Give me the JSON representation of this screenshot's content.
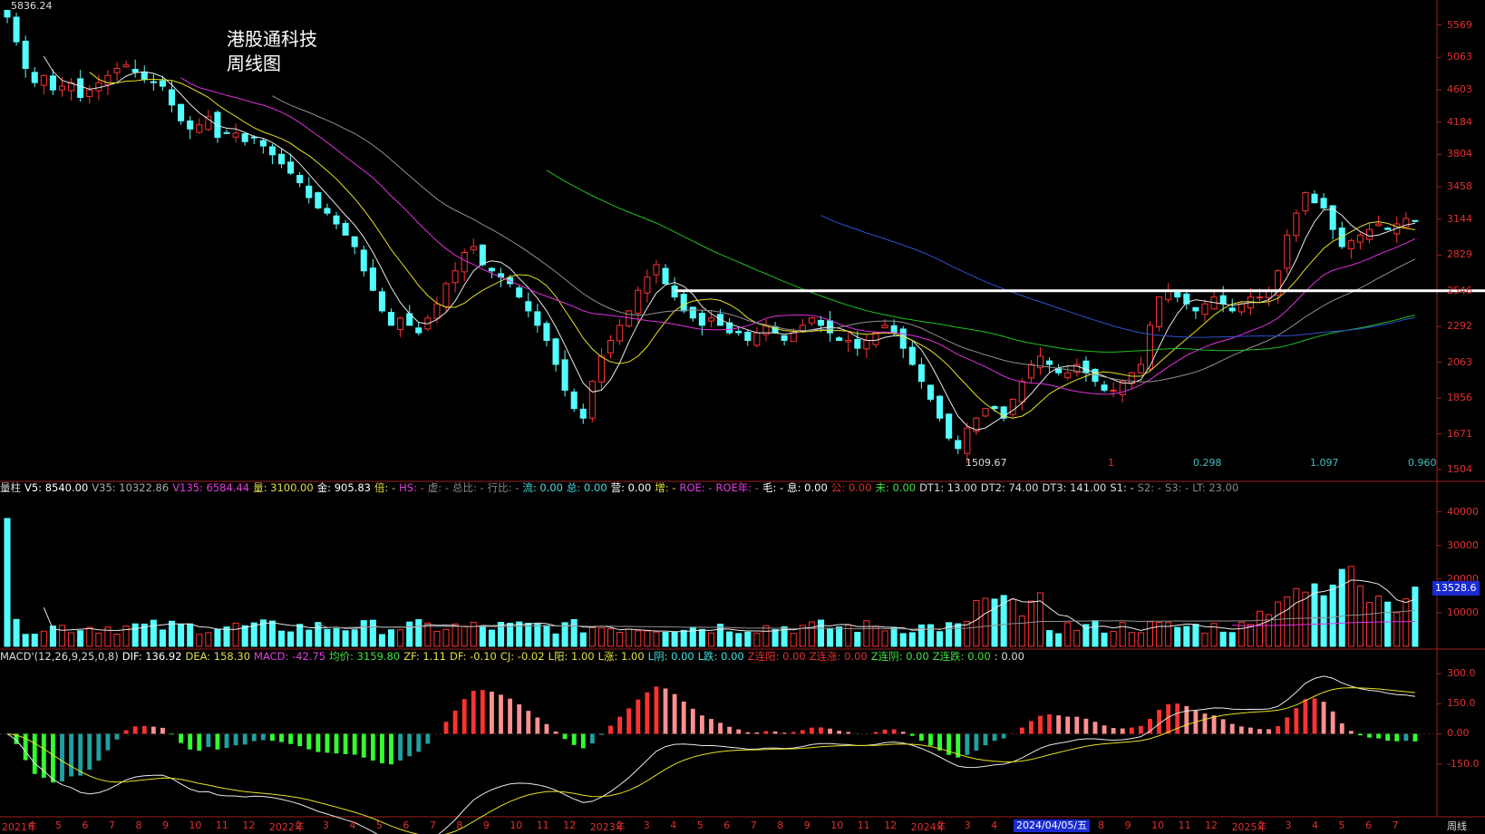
{
  "header": {
    "high_label": "5836.24"
  },
  "title": {
    "line1": "港股通科技",
    "line2": "周线图"
  },
  "price_axis": [
    "5569",
    "5063",
    "4603",
    "4184",
    "3804",
    "3458",
    "3144",
    "2829",
    "2546",
    "2292",
    "2063",
    "1856",
    "1671",
    "1504"
  ],
  "price_markers": {
    "low_label": "1509.67",
    "m1": "1",
    "m2": "0.298",
    "m3": "1.097",
    "m4": "0.960"
  },
  "volume_axis": [
    "40000",
    "30000",
    "20000",
    "10000"
  ],
  "volume_badge": "13528.6",
  "macd_axis": [
    "300.0",
    "150.0",
    "0.00",
    "-150.0"
  ],
  "volume_header": [
    {
      "k": "vol_title",
      "t": "量柱",
      "c": "#dddddd"
    },
    {
      "k": "v5",
      "t": "V5: 8540.00",
      "c": "#ffffff"
    },
    {
      "k": "v35",
      "t": "V35: 10322.86",
      "c": "#aaaaaa"
    },
    {
      "k": "v135",
      "t": "V135: 6584.44",
      "c": "#e040e0"
    },
    {
      "k": "liang",
      "t": "量: 3100.00",
      "c": "#e0e040"
    },
    {
      "k": "jin",
      "t": "金: 905.83",
      "c": "#ffffff"
    },
    {
      "k": "bei",
      "t": "倍: -",
      "c": "#e0e040"
    },
    {
      "k": "hs",
      "t": "HS: -",
      "c": "#e040e0"
    },
    {
      "k": "xu",
      "t": "虚: -",
      "c": "#888888"
    },
    {
      "k": "zongbi",
      "t": "总比: -",
      "c": "#888888"
    },
    {
      "k": "hangbi",
      "t": "行比: -",
      "c": "#888888"
    },
    {
      "k": "liu",
      "t": "流: 0.00",
      "c": "#40e0e0"
    },
    {
      "k": "zong",
      "t": "总: 0.00",
      "c": "#40e0e0"
    },
    {
      "k": "ying",
      "t": "营: 0.00",
      "c": "#ffffff"
    },
    {
      "k": "zeng",
      "t": "增: -",
      "c": "#e0e040"
    },
    {
      "k": "roe",
      "t": "ROE: -",
      "c": "#e040e0"
    },
    {
      "k": "roey",
      "t": "ROE年: -",
      "c": "#e040e0"
    },
    {
      "k": "mao",
      "t": "毛: -",
      "c": "#ffffff"
    },
    {
      "k": "xi",
      "t": "息: 0.00",
      "c": "#ffffff"
    },
    {
      "k": "gong",
      "t": "公: 0.00",
      "c": "#e03030"
    },
    {
      "k": "wei",
      "t": "未: 0.00",
      "c": "#40e040"
    },
    {
      "k": "dt1",
      "t": "DT1: 13.00",
      "c": "#dddddd"
    },
    {
      "k": "dt2",
      "t": "DT2: 74.00",
      "c": "#dddddd"
    },
    {
      "k": "dt3",
      "t": "DT3: 141.00",
      "c": "#dddddd"
    },
    {
      "k": "s1",
      "t": "S1: -",
      "c": "#dddddd"
    },
    {
      "k": "s2",
      "t": "S2: -",
      "c": "#888888"
    },
    {
      "k": "s3",
      "t": "S3: -",
      "c": "#888888"
    },
    {
      "k": "lt",
      "t": "LT: 23.00",
      "c": "#888888"
    }
  ],
  "macd_header": [
    {
      "k": "macd_title",
      "t": "MACD'(12,26,9,25,0,8)",
      "c": "#dddddd"
    },
    {
      "k": "dif",
      "t": "DIF: 136.92",
      "c": "#ffffff"
    },
    {
      "k": "dea",
      "t": "DEA: 158.30",
      "c": "#e0e040"
    },
    {
      "k": "macd",
      "t": "MACD: -42.75",
      "c": "#e040e0"
    },
    {
      "k": "junjia",
      "t": "均价: 3159.80",
      "c": "#40e040"
    },
    {
      "k": "zf",
      "t": "ZF: 1.11",
      "c": "#e0e040"
    },
    {
      "k": "df",
      "t": "DF: -0.10",
      "c": "#e0e040"
    },
    {
      "k": "cj",
      "t": "CJ: -0.02",
      "c": "#e0e040"
    },
    {
      "k": "lyang",
      "t": "L阳: 1.00",
      "c": "#e0e040"
    },
    {
      "k": "lzhang",
      "t": "L涨: 1.00",
      "c": "#e0e040"
    },
    {
      "k": "lming",
      "t": "L阴: 0.00",
      "c": "#40e0e0"
    },
    {
      "k": "ldie",
      "t": "L跌: 0.00",
      "c": "#40e0e0"
    },
    {
      "k": "zlyang",
      "t": "Z连阳: 0.00",
      "c": "#e03030"
    },
    {
      "k": "zlzhang",
      "t": "Z连涨: 0.00",
      "c": "#e03030"
    },
    {
      "k": "zlyin",
      "t": "Z连阴: 0.00",
      "c": "#40e040"
    },
    {
      "k": "zldie",
      "t": "Z连跌: 0.00",
      "c": "#40e040"
    },
    {
      "k": "tail",
      "t": ": 0.00",
      "c": "#dddddd"
    }
  ],
  "x_axis": [
    {
      "t": "2021年"
    },
    {
      "t": "4"
    },
    {
      "t": "5"
    },
    {
      "t": "6"
    },
    {
      "t": "7"
    },
    {
      "t": "8"
    },
    {
      "t": "9"
    },
    {
      "t": "10"
    },
    {
      "t": "11"
    },
    {
      "t": "12"
    },
    {
      "t": "2022年"
    },
    {
      "t": "2"
    },
    {
      "t": "3"
    },
    {
      "t": "4"
    },
    {
      "t": "5"
    },
    {
      "t": "6"
    },
    {
      "t": "7"
    },
    {
      "t": "8"
    },
    {
      "t": "9"
    },
    {
      "t": "10"
    },
    {
      "t": "11"
    },
    {
      "t": "12"
    },
    {
      "t": "2023年"
    },
    {
      "t": "2"
    },
    {
      "t": "3"
    },
    {
      "t": "4"
    },
    {
      "t": "5"
    },
    {
      "t": "6"
    },
    {
      "t": "7"
    },
    {
      "t": "8"
    },
    {
      "t": "9"
    },
    {
      "t": "10"
    },
    {
      "t": "11"
    },
    {
      "t": "12"
    },
    {
      "t": "2024年"
    },
    {
      "t": "2"
    },
    {
      "t": "3"
    },
    {
      "t": "4"
    },
    {
      "t": "5"
    },
    {
      "t": "6"
    },
    {
      "t": "7"
    },
    {
      "t": "8"
    },
    {
      "t": "9"
    },
    {
      "t": "10"
    },
    {
      "t": "11"
    },
    {
      "t": "12"
    },
    {
      "t": "2025年"
    },
    {
      "t": "2"
    },
    {
      "t": "3"
    },
    {
      "t": "4"
    },
    {
      "t": "5"
    },
    {
      "t": "6"
    },
    {
      "t": "7"
    }
  ],
  "date_badge": "2024/04/05/五",
  "period_label": "周线",
  "chart_data": {
    "type": "candlestick",
    "title": "港股通科技 周线图",
    "price_ylim": [
      1504,
      5836.24
    ],
    "reference_level": 2546,
    "closes": [
      5700,
      5300,
      4900,
      4700,
      4800,
      4600,
      4650,
      4700,
      4500,
      4600,
      4700,
      4800,
      4900,
      4950,
      4850,
      4750,
      4700,
      4650,
      4400,
      4200,
      4100,
      4150,
      4250,
      4000,
      4050,
      4050,
      3950,
      4000,
      3900,
      3800,
      3700,
      3600,
      3500,
      3350,
      3250,
      3200,
      3100,
      3000,
      2900,
      2700,
      2550,
      2400,
      2300,
      2350,
      2300,
      2250,
      2350,
      2450,
      2600,
      2700,
      2850,
      2900,
      2750,
      2700,
      2650,
      2600,
      2500,
      2400,
      2300,
      2200,
      2050,
      1900,
      1800,
      1750,
      1950,
      2100,
      2200,
      2300,
      2400,
      2550,
      2650,
      2750,
      2600,
      2500,
      2400,
      2350,
      2300,
      2350,
      2300,
      2250,
      2250,
      2200,
      2250,
      2300,
      2250,
      2200,
      2250,
      2300,
      2350,
      2300,
      2250,
      2200,
      2200,
      2150,
      2200,
      2250,
      2300,
      2250,
      2150,
      2050,
      1950,
      1850,
      1750,
      1650,
      1600,
      1700,
      1750,
      1800,
      1800,
      1750,
      1850,
      1950,
      2050,
      2100,
      2050,
      2000,
      2000,
      2050,
      2000,
      1950,
      1900,
      1900,
      1950,
      2000,
      2050,
      2300,
      2500,
      2550,
      2500,
      2450,
      2400,
      2450,
      2500,
      2450,
      2400,
      2450,
      2500,
      2500,
      2550,
      2700,
      3000,
      3200,
      3400,
      3300,
      3250,
      3050,
      2900,
      2950,
      3000,
      3050,
      3100,
      3050,
      3100,
      3150,
      3130
    ],
    "volume_ylim": [
      0,
      45000
    ],
    "macd_ylim": [
      -400,
      350
    ]
  }
}
